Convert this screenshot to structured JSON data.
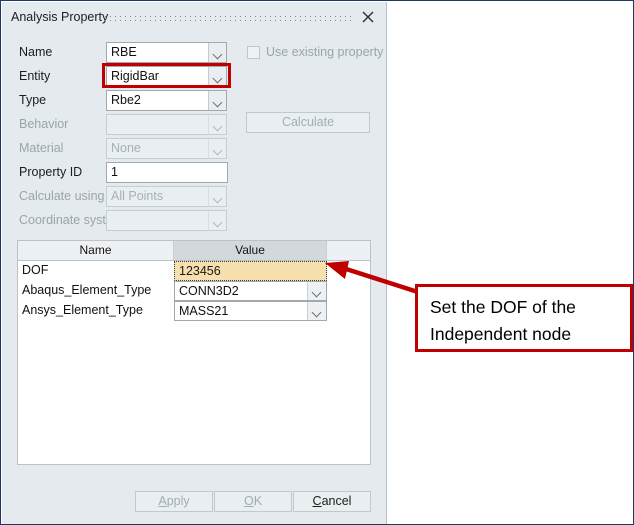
{
  "window": {
    "title": "Analysis Property",
    "close_icon": "close-x-icon",
    "grip_icon": "drag-grip-dots"
  },
  "form": {
    "fields": [
      {
        "label": "Name",
        "value": "RBE",
        "disabled": false,
        "has_arrow": true
      },
      {
        "label": "Entity",
        "value": "RigidBar",
        "disabled": false,
        "has_arrow": true
      },
      {
        "label": "Type",
        "value": "Rbe2",
        "disabled": false,
        "has_arrow": true
      },
      {
        "label": "Behavior",
        "value": "",
        "disabled": true,
        "has_arrow": true
      },
      {
        "label": "Material",
        "value": "None",
        "disabled": true,
        "has_arrow": true
      },
      {
        "label": "Property ID",
        "value": "1",
        "disabled": false,
        "has_arrow": false
      },
      {
        "label": "Calculate using",
        "value": "All Points",
        "disabled": true,
        "has_arrow": true
      },
      {
        "label": "Coordinate system",
        "value": "",
        "disabled": true,
        "has_arrow": true
      }
    ],
    "use_existing_property": {
      "label": "Use existing property",
      "checked": false,
      "disabled": true
    },
    "calculate_button": {
      "label": "Calculate",
      "disabled": true
    }
  },
  "table": {
    "columns": [
      "Name",
      "Value",
      ""
    ],
    "rows": [
      {
        "name": "DOF",
        "value": "123456",
        "editor": "text",
        "highlighted": true
      },
      {
        "name": "Abaqus_Element_Type",
        "value": "CONN3D2",
        "editor": "combo",
        "highlighted": false
      },
      {
        "name": "Ansys_Element_Type",
        "value": "MASS21",
        "editor": "combo",
        "highlighted": false
      }
    ]
  },
  "footer": {
    "apply": {
      "label": "Apply",
      "accel": "A",
      "disabled": true
    },
    "ok": {
      "label": "OK",
      "accel": "O",
      "disabled": true
    },
    "cancel": {
      "label": "Cancel",
      "accel": "C",
      "disabled": false
    }
  },
  "annotation": {
    "line1": "Set the DOF of the",
    "line2": "Independent node",
    "color": "#c00000"
  }
}
